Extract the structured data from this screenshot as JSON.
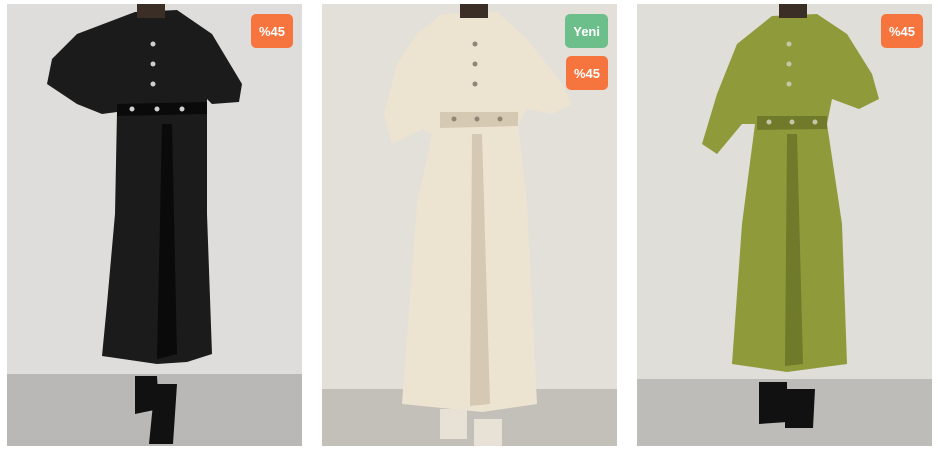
{
  "products": [
    {
      "name": "black-dress",
      "colors": {
        "dress": "#1b1b1b",
        "shade": "#0a0a0a",
        "wall": "#dedddb",
        "floor": "#b9b8b6"
      },
      "badges": [
        {
          "label": "%45",
          "color": "#f6743d"
        }
      ]
    },
    {
      "name": "cream-dress",
      "colors": {
        "dress": "#ede3d1",
        "shade": "#d6c9b3",
        "wall": "#e3e0d9",
        "floor": "#c3c0ba"
      },
      "badges": [
        {
          "label": "Yeni",
          "color": "#6cbf8a"
        },
        {
          "label": "%45",
          "color": "#f6743d"
        }
      ]
    },
    {
      "name": "olive-dress",
      "colors": {
        "dress": "#8f9a3a",
        "shade": "#6f7a2a",
        "wall": "#dfded9",
        "floor": "#bdbcb8"
      },
      "badges": [
        {
          "label": "%45",
          "color": "#f6743d"
        }
      ]
    }
  ]
}
